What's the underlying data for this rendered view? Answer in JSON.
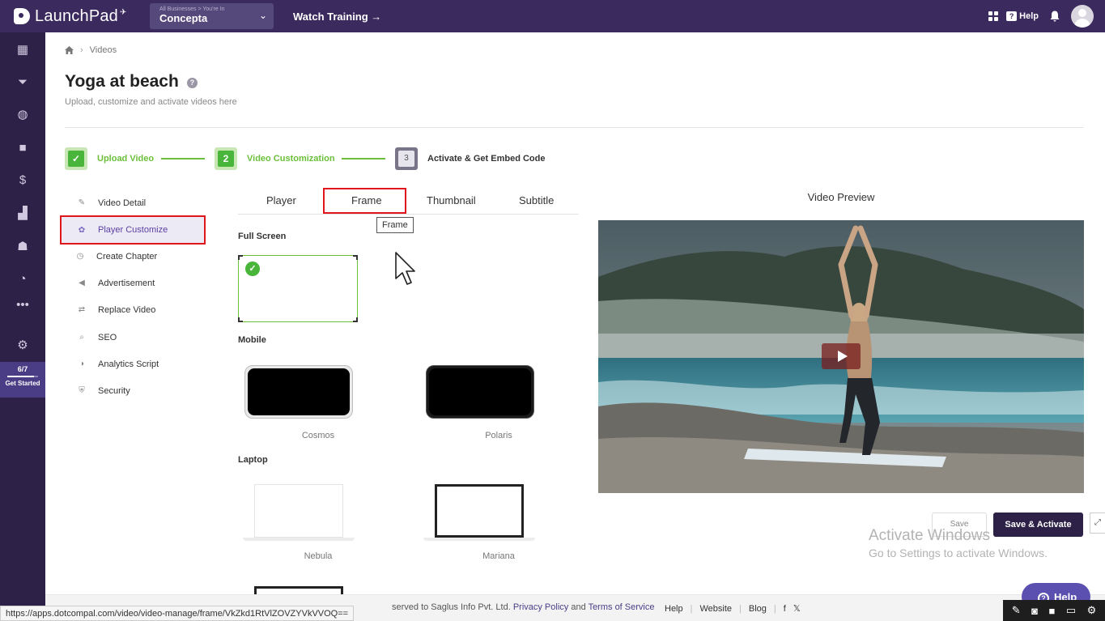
{
  "topbar": {
    "app_name": "LaunchPad",
    "business_small": "All Businesses > You're In",
    "business_name": "Concepta",
    "watch_training": "Watch Training →",
    "help_label": "Help"
  },
  "rail": {
    "items": [
      "dashboard-icon",
      "funnel-icon",
      "globe-icon",
      "video-icon",
      "dollar-icon",
      "chart-icon",
      "people-icon",
      "analytics-icon",
      "more-icon",
      "settings-icon"
    ],
    "progress_count": "6/7",
    "progress_fraction": 0.857,
    "progress_label": "Get Started"
  },
  "breadcrumb": {
    "current": "Videos"
  },
  "page": {
    "title": "Yoga at beach",
    "subtitle": "Upload, customize and activate videos here"
  },
  "steps": [
    {
      "number": "✓",
      "label": "Upload Video"
    },
    {
      "number": "2",
      "label": "Video Customization"
    },
    {
      "number": "3",
      "label": "Activate & Get Embed Code"
    }
  ],
  "menu": [
    {
      "label": "Video Detail",
      "icon": "edit-icon"
    },
    {
      "label": "Player Customize",
      "icon": "palette-icon"
    },
    {
      "label": "Create Chapter",
      "icon": "timer-icon"
    },
    {
      "label": "Advertisement",
      "icon": "megaphone-icon"
    },
    {
      "label": "Replace Video",
      "icon": "swap-icon"
    },
    {
      "label": "SEO",
      "icon": "search-icon"
    },
    {
      "label": "Analytics Script",
      "icon": "analytics-icon"
    },
    {
      "label": "Security",
      "icon": "shield-icon"
    }
  ],
  "tabs": [
    "Player",
    "Frame",
    "Thumbnail",
    "Subtitle"
  ],
  "tooltip": "Frame",
  "frames": {
    "full_screen_label": "Full Screen",
    "mobile_label": "Mobile",
    "laptop_label": "Laptop",
    "mobile": [
      "Cosmos",
      "Polaris"
    ],
    "laptop": [
      "Nebula",
      "Mariana"
    ]
  },
  "preview": {
    "title": "Video Preview"
  },
  "actions": {
    "save": "Save",
    "save_activate": "Save & Activate"
  },
  "watermark": {
    "line1": "Activate Windows",
    "line2": "Go to Settings to activate Windows."
  },
  "help_fab": "Help",
  "footer": {
    "copyright": "served to Saglus Info Pvt. Ltd.",
    "privacy": "Privacy Policy",
    "and": "and",
    "terms": "Terms of Service",
    "links": [
      "Help",
      "Website",
      "Blog"
    ]
  },
  "status_url": "https://apps.dotcompal.com/video/video-manage/frame/VkZkd1RtVlZOVZYVkVVOQ=="
}
